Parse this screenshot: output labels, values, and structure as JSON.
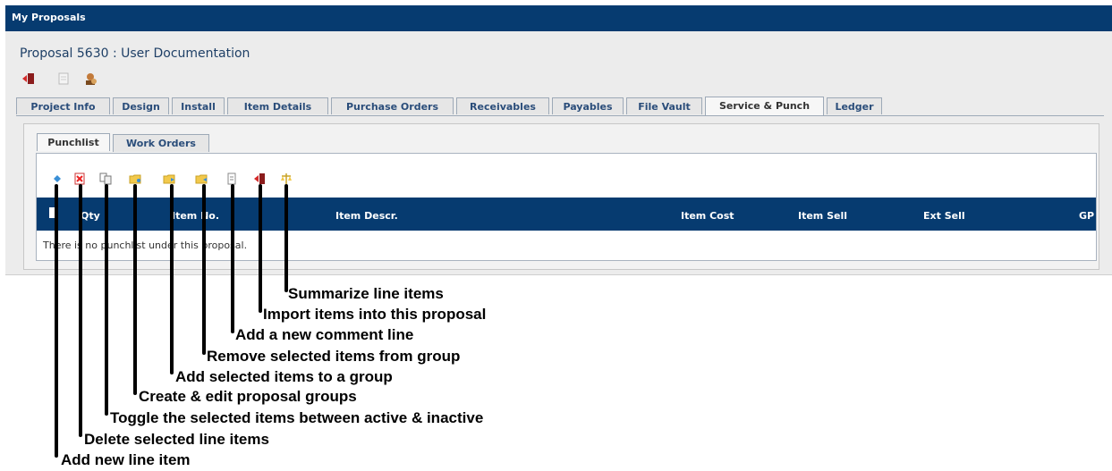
{
  "window": {
    "title": "My Proposals"
  },
  "proposal": {
    "title": "Proposal 5630 : User Documentation"
  },
  "top_icons": [
    "close-door-icon",
    "document-icon",
    "user-settings-icon"
  ],
  "tabs": [
    {
      "label": "Project Info",
      "active": false
    },
    {
      "label": "Design",
      "active": false
    },
    {
      "label": "Install",
      "active": false
    },
    {
      "label": "Item Details",
      "active": false
    },
    {
      "label": "Purchase Orders",
      "active": false
    },
    {
      "label": "Receivables",
      "active": false
    },
    {
      "label": "Payables",
      "active": false
    },
    {
      "label": "File Vault",
      "active": false
    },
    {
      "label": "Service & Punch",
      "active": true
    },
    {
      "label": "Ledger",
      "active": false
    }
  ],
  "subtabs": [
    {
      "label": "Punchlist",
      "active": true
    },
    {
      "label": "Work Orders",
      "active": false
    }
  ],
  "toolbar": [
    {
      "icon": "add-diamond-icon",
      "caption": "Add new line item"
    },
    {
      "icon": "delete-doc-icon",
      "caption": "Delete selected line items"
    },
    {
      "icon": "toggle-copy-icon",
      "caption": "Toggle the selected items between active & inactive"
    },
    {
      "icon": "folder-edit-icon",
      "caption": "Create & edit proposal groups"
    },
    {
      "icon": "folder-add-icon",
      "caption": "Add selected items to a group"
    },
    {
      "icon": "folder-remove-icon",
      "caption": "Remove selected items from group"
    },
    {
      "icon": "comment-page-icon",
      "caption": "Add a new comment line"
    },
    {
      "icon": "import-icon",
      "caption": "Import items into this proposal"
    },
    {
      "icon": "summarize-icon",
      "caption": "Summarize line items"
    }
  ],
  "table": {
    "columns": [
      "Qty",
      "Item No.",
      "Item Descr.",
      "Item Cost",
      "Item Sell",
      "Ext Sell",
      "GP"
    ],
    "empty_message": "There is no punchlist under this proposal."
  },
  "colors": {
    "header_blue": "#063b70",
    "panel_gray": "#ececec",
    "tab_text": "#2a4d7a"
  }
}
